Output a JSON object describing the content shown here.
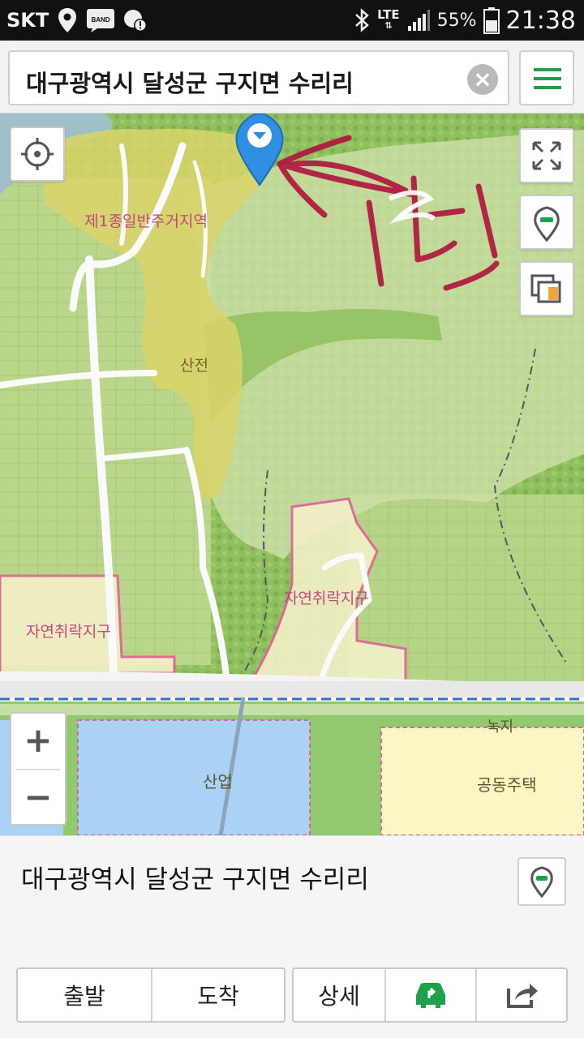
{
  "status_bar": {
    "carrier": "SKT",
    "band_label": "BAND",
    "network": "LTE",
    "battery": "55%",
    "time": "21:38"
  },
  "search": {
    "query": "대구광역시 달성군 구지면 수리리"
  },
  "map": {
    "annotation": "1번",
    "zone_labels": {
      "residential": "제1종일반주거지역",
      "sanjeon": "산전",
      "village_left": "자연취락지구",
      "village_center": "자연취락지구",
      "green": "녹지",
      "industrial": "산업",
      "housing": "공동주택"
    },
    "zoom_in": "+",
    "zoom_out": "−"
  },
  "panel": {
    "address": "대구광역시 달성군 구지면 수리리",
    "buttons": {
      "depart": "출발",
      "arrive": "도착",
      "detail": "상세"
    }
  },
  "colors": {
    "accent": "#1fa14a",
    "marker": "#2f8fe3",
    "zone_yellow": "#d9d46a",
    "zone_pink": "#e0629a",
    "industrial_blue": "#a9d2f5",
    "housing_yellow": "#fbf6c3"
  }
}
